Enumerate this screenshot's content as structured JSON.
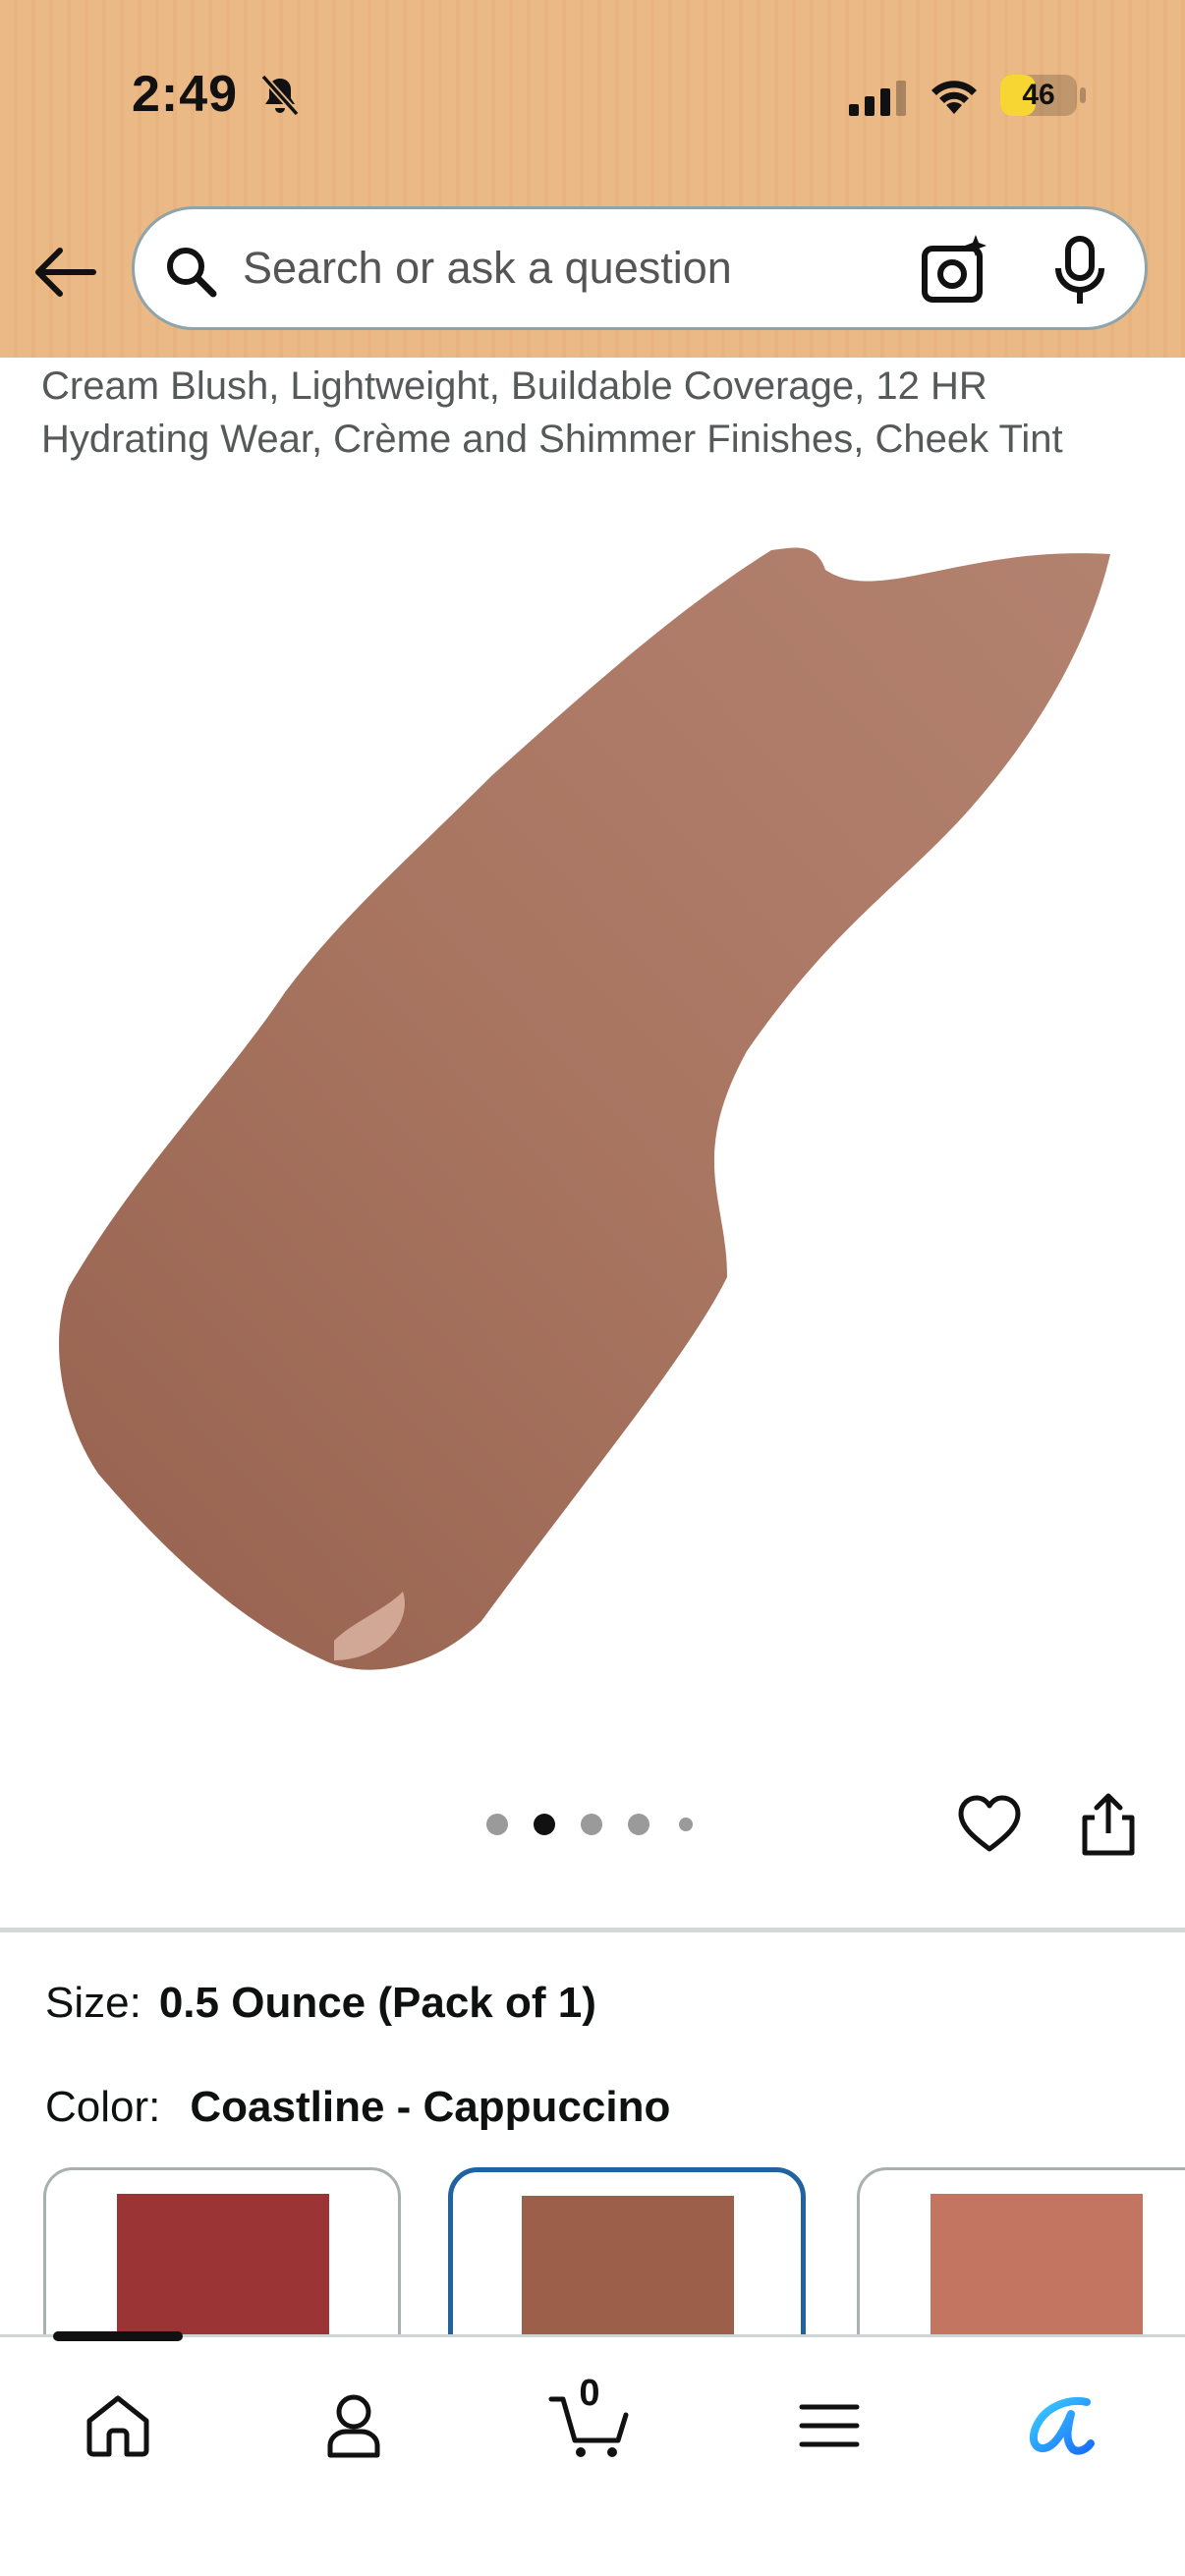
{
  "status_bar": {
    "time": "2:49",
    "battery_level": "46",
    "battery_fraction": 0.46
  },
  "header": {
    "search_placeholder": "Search or ask a question"
  },
  "product": {
    "title": "Cream Blush, Lightweight, Buildable Coverage, 12 HR Hydrating Wear, Crème and Shimmer Finishes, Cheek Tint",
    "image_color": "#a87561",
    "carousel": {
      "total_images": 5,
      "active_index": 1
    }
  },
  "variations": {
    "size_label": "Size:",
    "size_value": "0.5 Ounce (Pack of 1)",
    "color_label": "Color:",
    "color_value": "Coastline - Cappuccino",
    "swatches": [
      {
        "color": "#9b3535",
        "selected": false
      },
      {
        "color": "#9c5f4a",
        "selected": true
      },
      {
        "color": "#c47561",
        "selected": false
      }
    ]
  },
  "bottom_nav": {
    "cart_count": "0",
    "items": [
      "home-icon",
      "account-icon",
      "cart-icon",
      "menu-icon",
      "rufus-icon"
    ]
  },
  "colors": {
    "header_bg": "#eab986",
    "selected_border": "#2162a1",
    "rufus_blue": "#1a98ff",
    "battery_yellow": "#f7d633"
  }
}
